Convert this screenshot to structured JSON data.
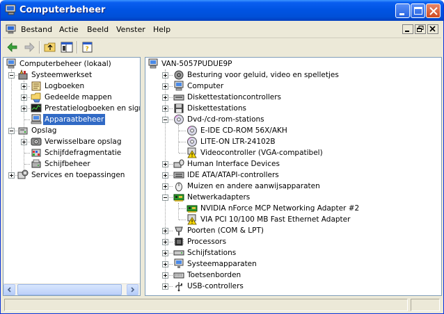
{
  "window": {
    "title": "Computerbeheer",
    "title_bar_color": "#0054e3",
    "controls": [
      "minimize-icon",
      "maximize-icon",
      "close-icon"
    ]
  },
  "menubar": {
    "items": [
      "Bestand",
      "Actie",
      "Beeld",
      "Venster",
      "Help"
    ]
  },
  "toolbar": {
    "buttons": [
      "back-arrow-icon",
      "forward-arrow-icon",
      "up-folder-icon",
      "show-hide-tree-icon",
      "properties-help-icon"
    ]
  },
  "left_tree": {
    "root": "Computerbeheer (lokaal)",
    "nodes": [
      {
        "label": "Systeemwerkset",
        "icon": "tools-icon",
        "expanded": true
      },
      {
        "label": "Logboeken",
        "icon": "event-viewer-icon"
      },
      {
        "label": "Gedeelde mappen",
        "icon": "shared-folder-icon"
      },
      {
        "label": "Prestatielogboeken en signal",
        "icon": "performance-icon"
      },
      {
        "label": "Apparaatbeheer",
        "icon": "device-manager-icon",
        "selected": true
      },
      {
        "label": "Opslag",
        "icon": "storage-icon",
        "expanded": true
      },
      {
        "label": "Verwisselbare opslag",
        "icon": "removable-storage-icon"
      },
      {
        "label": "Schijfdefragmentatie",
        "icon": "defrag-icon"
      },
      {
        "label": "Schijfbeheer",
        "icon": "disk-management-icon"
      },
      {
        "label": "Services en toepassingen",
        "icon": "services-icon"
      }
    ]
  },
  "device_tree": {
    "root": "VAN-5057PUDUE9P",
    "categories": [
      {
        "label": "Besturing voor geluid, video en spelletjes",
        "icon": "sound-icon"
      },
      {
        "label": "Computer",
        "icon": "computer-icon"
      },
      {
        "label": "Diskettestationcontrollers",
        "icon": "floppy-controller-icon"
      },
      {
        "label": "Diskettestations",
        "icon": "floppy-drive-icon"
      },
      {
        "label": "Dvd-/cd-rom-stations",
        "icon": "cdrom-icon",
        "expanded": true,
        "children": [
          {
            "label": "E-IDE CD-ROM 56X/AKH",
            "icon": "cdrom-icon"
          },
          {
            "label": "LITE-ON LTR-24102B",
            "icon": "cdrom-icon"
          },
          {
            "label": "Videocontroller (VGA-compatibel)",
            "icon": "warning-icon"
          }
        ]
      },
      {
        "label": "Human Interface Devices",
        "icon": "hid-icon"
      },
      {
        "label": "IDE ATA/ATAPI-controllers",
        "icon": "ide-icon"
      },
      {
        "label": "Muizen en andere aanwijsapparaten",
        "icon": "mouse-icon"
      },
      {
        "label": "Netwerkadapters",
        "icon": "network-adapter-icon",
        "expanded": true,
        "children": [
          {
            "label": "NVIDIA nForce MCP Networking Adapter #2",
            "icon": "network-adapter-icon"
          },
          {
            "label": "VIA PCI 10/100 MB Fast Ethernet Adapter",
            "icon": "warning-icon"
          }
        ]
      },
      {
        "label": "Poorten (COM & LPT)",
        "icon": "port-icon"
      },
      {
        "label": "Processors",
        "icon": "processor-icon"
      },
      {
        "label": "Schijfstations",
        "icon": "disk-drive-icon"
      },
      {
        "label": "Systeemapparaten",
        "icon": "system-device-icon"
      },
      {
        "label": "Toetsenborden",
        "icon": "keyboard-icon"
      },
      {
        "label": "USB-controllers",
        "icon": "usb-icon"
      }
    ]
  },
  "colors": {
    "selection": "#316ac5",
    "window_bg": "#ece9d8",
    "warning": "#f8d800"
  }
}
